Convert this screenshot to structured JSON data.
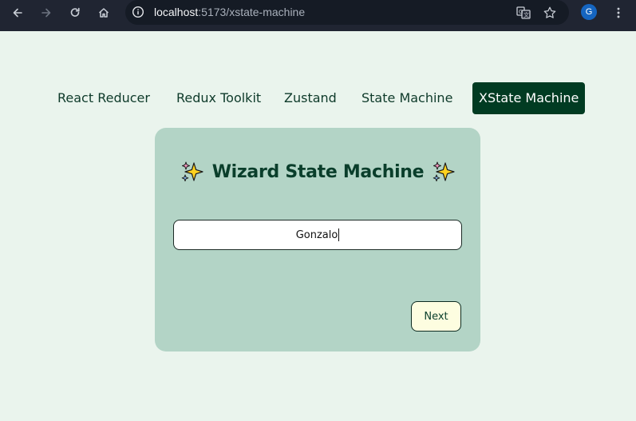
{
  "browser": {
    "url_host": "localhost",
    "url_rest": ":5173/xstate-machine",
    "profile_initial": "G"
  },
  "nav": {
    "tabs": [
      {
        "label": "React Reducer"
      },
      {
        "label": "Redux Toolkit"
      },
      {
        "label": "Zustand"
      },
      {
        "label": "State Machine"
      },
      {
        "label": "XState Machine"
      }
    ],
    "active_tab": "XState Machine"
  },
  "wizard": {
    "title": "Wizard State Machine",
    "name_value": "Gonzalo",
    "next_label": "Next"
  },
  "colors": {
    "page_background": "#eaf4ed",
    "card_background": "#b3d4c6",
    "active_tab_background": "#013b22",
    "title_color": "#0a3e2b",
    "next_button_background": "#fdfde0"
  }
}
